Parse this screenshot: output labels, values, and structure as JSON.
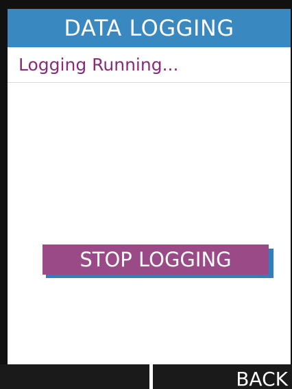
{
  "screen": {
    "title": "DATA LOGGING",
    "status_text": "Logging Running..."
  },
  "actions": {
    "stop_label": "STOP LOGGING"
  },
  "softkeys": {
    "left_label": "",
    "right_label": "BACK"
  },
  "colors": {
    "title_bar": "#3a88c0",
    "status_text": "#8a2a7a",
    "button_fill": "#9a4a86",
    "button_shadow": "#2f7fc0",
    "softkey_bg": "#1a1a1a"
  }
}
